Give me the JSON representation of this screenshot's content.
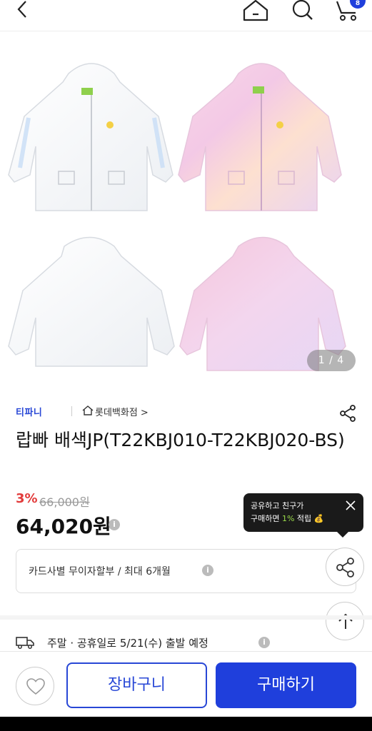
{
  "header": {
    "cart_count": "8"
  },
  "gallery": {
    "counter": "1 / 4"
  },
  "brand": {
    "logo_text": "티파니",
    "store": "롯데백화점 >"
  },
  "product": {
    "title": "랍빠 배색JP(T22KBJ010-T22KBJ020-BS)",
    "discount": "3%",
    "original_price": "66,000원",
    "price": "64,020원"
  },
  "tooltip": {
    "line1": "공유하고 친구가",
    "line2_a": "구매하면 ",
    "line2_pct": "1%",
    "line2_b": " 적립"
  },
  "installment": {
    "text": "카드사별 무이자할부 / 최대 6개월"
  },
  "shipping": {
    "text": "주말 · 공휴일로 5/21(수) 출발 예정"
  },
  "actions": {
    "cart_label": "장바구니",
    "buy_label": "구매하기"
  },
  "colors": {
    "accent": "#1f3fdc",
    "discount": "#e23b3b"
  }
}
